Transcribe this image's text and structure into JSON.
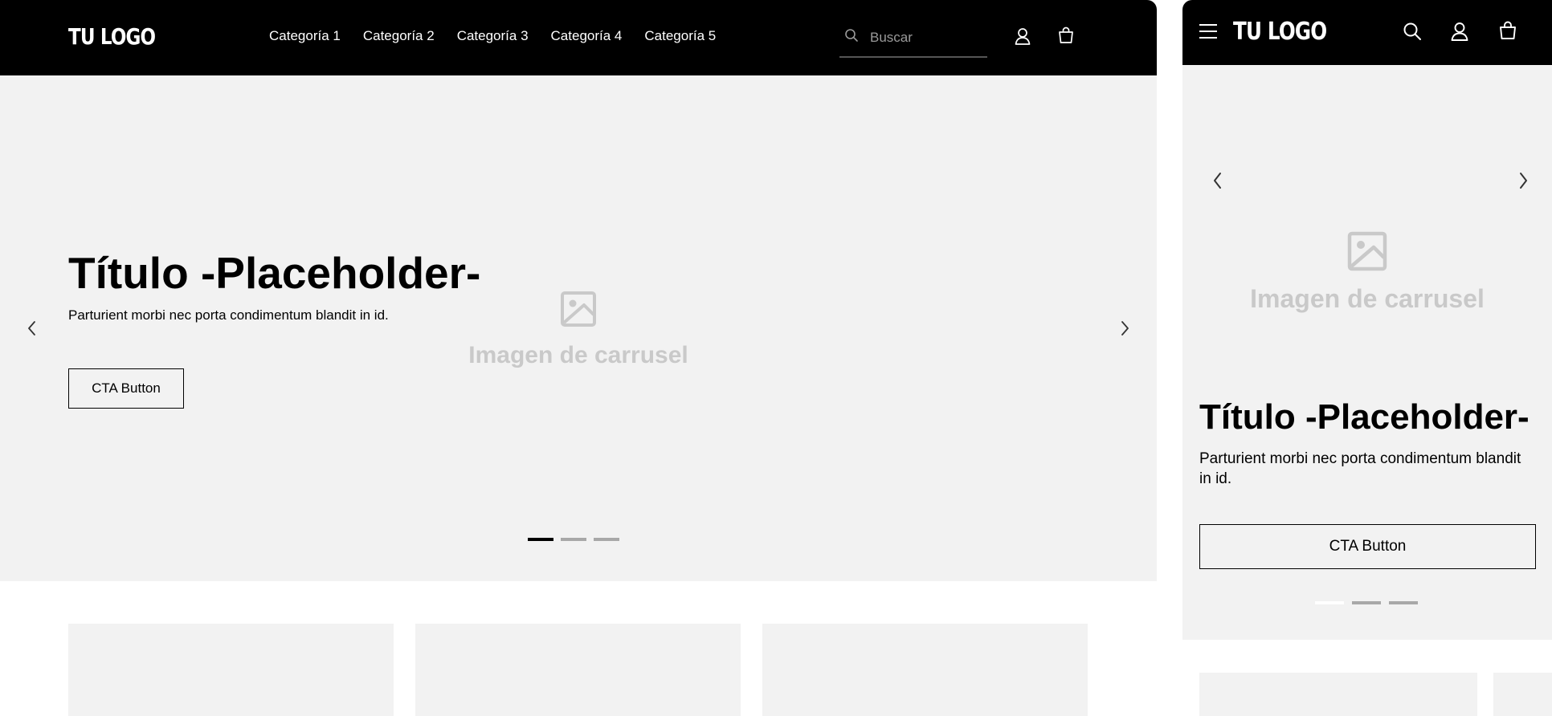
{
  "desktop": {
    "logo": "TU LOGO",
    "nav": [
      "Categoría 1",
      "Categoría 2",
      "Categoría 3",
      "Categoría 4",
      "Categoría 5"
    ],
    "search": {
      "placeholder": "Buscar"
    },
    "icons": {
      "search": "search-icon",
      "account": "user-icon",
      "cart": "shopping-bag-icon",
      "prev": "chevron-left-icon",
      "next": "chevron-right-icon",
      "image": "image-placeholder-icon"
    },
    "hero": {
      "title": "Título -Placeholder-",
      "subtitle": "Parturient morbi nec porta condimentum blandit in id.",
      "cta": "CTA Button",
      "image_label": "Imagen de carrusel",
      "slides_total": 3,
      "active_slide": 1
    }
  },
  "mobile": {
    "logo": "TU LOGO",
    "icons": {
      "menu": "hamburger-menu-icon",
      "search": "search-icon",
      "account": "user-icon",
      "cart": "shopping-bag-icon",
      "prev": "chevron-left-icon",
      "next": "chevron-right-icon",
      "image": "image-placeholder-icon"
    },
    "hero": {
      "title": "Título -Placeholder-",
      "subtitle": "Parturient morbi nec porta condimentum blandit in id.",
      "cta": "CTA Button",
      "image_label": "Imagen de carrusel",
      "slides_total": 3,
      "active_slide": 1
    }
  },
  "colors": {
    "header_bg": "#000000",
    "hero_bg": "#f2f2f2",
    "placeholder_text": "#c9c9c9",
    "dot_inactive": "#a8a8a8"
  }
}
